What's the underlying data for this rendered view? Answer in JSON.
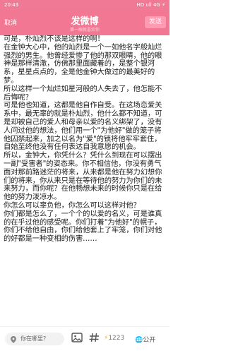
{
  "status": {
    "time": "20:43",
    "indicators": "HD ull 4G",
    "battery": "⚡"
  },
  "header": {
    "cancel": "取消",
    "title": "发微博",
    "subtitle": "第一眼就喜欢你",
    "send": "发送"
  },
  "content": {
    "text": "可是，朴灿烈不该是这样的啊！\n在金钟大心中，他的灿烈是一个一如他名字般灿烂强烈的男生。他曾经爱惨了他的那双眼睛，他的眼神是那样清澈，仿佛那里面藏着的，是整个银河系，星星点点的，全是他金钟大做过的最美好的梦。\n所以这样一个灿烂如星河般的人失去了，他怎能不后悔呢？\n可是他也知道，这都是他自作自受。在这场恋爱关系中，最无辜的就是朴灿烈，他什么都不知道，可是却被自己的爱人和母亲以爱的名义绑架了，没有人问过他的想法，他们用一个\"为他好\"做的笼子将他囚禁起来，加之以名为\"爱\"的锁将他牢牢套住，自始至终他没有任何表达自我意愿的机会。\n所以，金钟大，你凭什么？凭什么到现在可以摆出一副\"受害者\"的姿态来。你不相信他，你没有勇气面对那前路迷茫的将来，从来都是他在努力幻想你们的将来，你从来只是在等待他的努力为你们的未来努力，而你呢？在他畅想未来的时候你只是在给他的努力泼凉水。\n你怎么可以辜负他，你怎么可以这样对他？\n你们都是怎么了，一个个的以爱的名义，可是谁真的在乎过他的感受呢。你们打着\"为他好\"的幌子，你们不给他自由，你们给他套上了牢笼，你们对他的好都是一种变相的伤害……"
  },
  "bottom": {
    "location_placeholder": "你在哪里?",
    "char_count": "1223",
    "visibility": "公开"
  },
  "colors": {
    "header_bg": "#f27793",
    "status_bg": "#f07a95"
  }
}
